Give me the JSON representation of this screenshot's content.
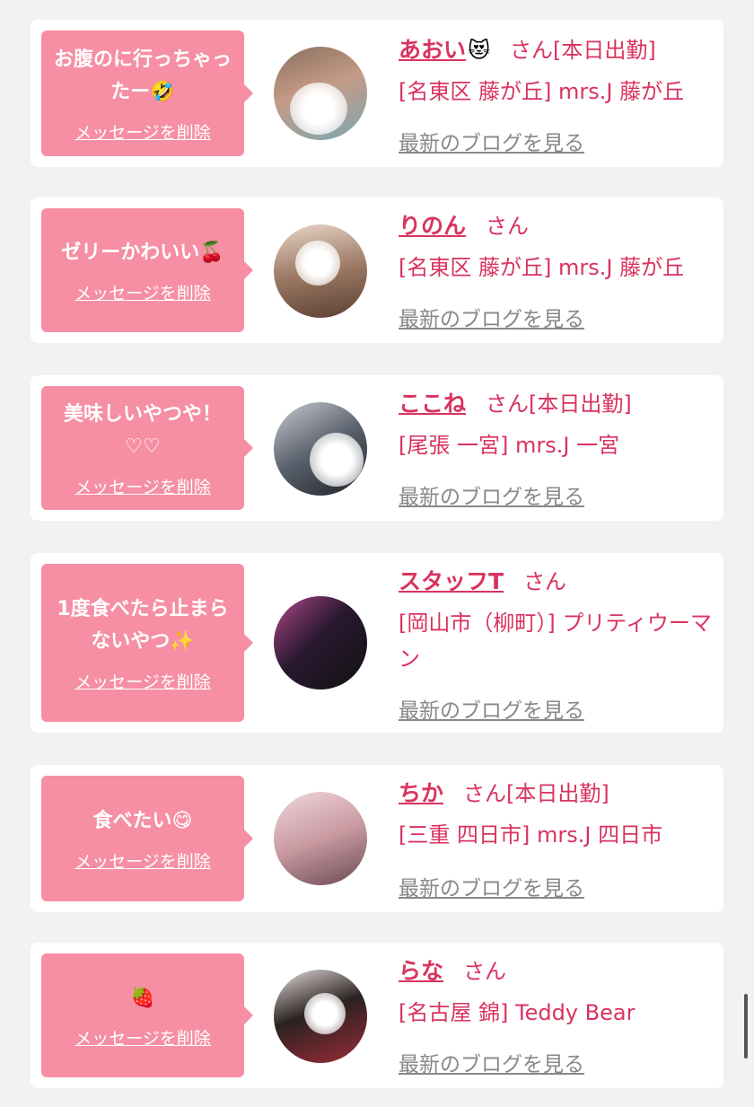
{
  "delete_label": "メッセージを削除",
  "blog_label": "最新のブログを見る",
  "san_label": "さん",
  "colors": {
    "accent": "#d9335f",
    "bubble": "#f68fa3",
    "link_gray": "#888888"
  },
  "cards": [
    {
      "message": "お腹のに行っちゃったー🤣",
      "name": "あおい",
      "name_emoji": "😻",
      "status": "[本日出勤]",
      "shop": "[名東区 藤が丘] mrs.J 藤が丘"
    },
    {
      "message": "ゼリーかわいい🍒",
      "name": "りのん",
      "name_emoji": "",
      "status": "",
      "shop": "[名東区 藤が丘] mrs.J 藤が丘"
    },
    {
      "message": "美味しいやつや！♡♡",
      "name": "ここね",
      "name_emoji": "",
      "status": "[本日出勤]",
      "shop": "[尾張 一宮] mrs.J 一宮"
    },
    {
      "message": "1度食べたら止まらないやつ✨",
      "name": "スタッフT",
      "name_emoji": "",
      "status": "",
      "shop": "[岡山市（柳町）] プリティウーマン"
    },
    {
      "message": "食べたい😋",
      "name": "ちか",
      "name_emoji": "",
      "status": "[本日出勤]",
      "shop": "[三重 四日市] mrs.J 四日市"
    },
    {
      "message": "🍓",
      "name": "らな",
      "name_emoji": "",
      "status": "",
      "shop": "[名古屋 錦] Teddy Bear"
    }
  ]
}
